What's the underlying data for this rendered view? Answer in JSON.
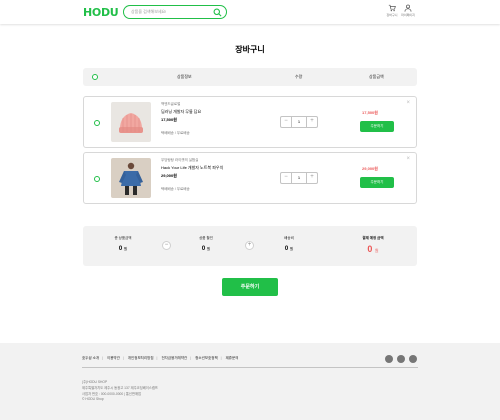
{
  "header": {
    "logo": "HODU",
    "search_placeholder": "상품을 검색해보세요!",
    "cart_label": "장바구니",
    "mypage_label": "마이페이지"
  },
  "page_title": "장바구니",
  "table_header": {
    "info": "상품정보",
    "qty": "수량",
    "price": "상품금액"
  },
  "items": [
    {
      "seller": "백엔드글로벌",
      "name": "딥러닝 개발자 무릎 담요",
      "price": "17,500원",
      "shipping": "택배배송 / 무료배송",
      "qty": "1",
      "total": "17,500원",
      "order_label": "주문하기",
      "thumb_color": "#f1a7a0"
    },
    {
      "seller": "우당탕탕 라이캣의 실험실",
      "name": "Hack Your Life 개발자 노트북 파우치",
      "price": "29,000원",
      "shipping": "택배배송 / 무료배송",
      "qty": "1",
      "total": "29,000원",
      "order_label": "주문하기",
      "thumb_color": "#3b6ba8"
    }
  ],
  "summary": {
    "subtotal_label": "총 상품금액",
    "subtotal": "0",
    "discount_label": "상품 할인",
    "discount": "0",
    "shipping_label": "배송비",
    "shipping": "0",
    "total_label": "결제 예정 금액",
    "total": "0",
    "unit": "원"
  },
  "checkout_label": "주문하기",
  "footer": {
    "links": [
      "호두샵 소개",
      "이용약관",
      "개인정보처리방침",
      "전자금융거래약관",
      "청소년보호정책",
      "제휴문의"
    ],
    "company": "(주)HODU SHOP",
    "address": "제주특별자치도 제주시 동광고 137 제주코딩베이스캠프",
    "ceo": "사업자 번호 : 000-0000-0000 | 통신판매업",
    "copyright": "© HODU Shop"
  },
  "colors": {
    "brand": "#21bf48",
    "price_red": "#eb5757"
  }
}
